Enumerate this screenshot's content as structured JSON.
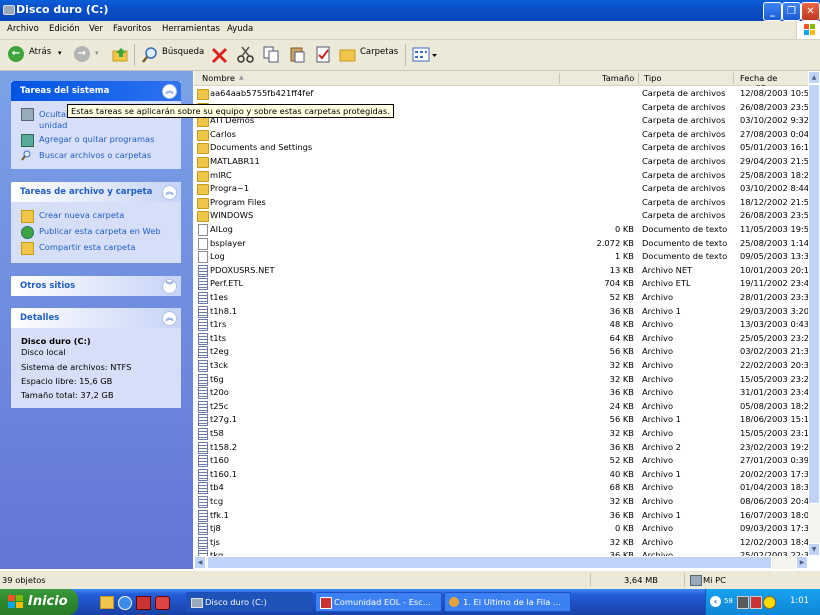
{
  "window": {
    "title": "Disco duro (C:)"
  },
  "menu": [
    "Archivo",
    "Edición",
    "Ver",
    "Favoritos",
    "Herramientas",
    "Ayuda"
  ],
  "toolbar": {
    "back": "Atrás",
    "search": "Búsqueda",
    "folders": "Carpetas"
  },
  "tooltip": "Estas tareas se aplicarán sobre su equipo y sobre estas carpetas protegidas.",
  "sidebar": {
    "system": {
      "title": "Tareas del sistema",
      "items": [
        "Ocultar el contenido de esta unidad",
        "Agregar o quitar programas",
        "Buscar archivos o carpetas"
      ]
    },
    "files": {
      "title": "Tareas de archivo y carpeta",
      "items": [
        "Crear nueva carpeta",
        "Publicar esta carpeta en Web",
        "Compartir esta carpeta"
      ]
    },
    "other": {
      "title": "Otros sitios"
    },
    "details": {
      "title": "Detalles",
      "name": "Disco duro (C:)",
      "type": "Disco local",
      "fs": "Sistema de archivos: NTFS",
      "free": "Espacio libre: 15,6 GB",
      "total": "Tamaño total: 37,2 GB"
    }
  },
  "columns": {
    "name": "Nombre",
    "size": "Tamaño",
    "type": "Tipo",
    "date": "Fecha de modific"
  },
  "files": [
    {
      "name": "aa64aab5755fb421ff4fef",
      "size": "",
      "type": "Carpeta de archivos",
      "date": "12/08/2003 10:50",
      "icon": "folder-icon"
    },
    {
      "name": "Adobe",
      "size": "",
      "type": "Carpeta de archivos",
      "date": "26/08/2003 23:51",
      "icon": "folder-icon"
    },
    {
      "name": "ATI Demos",
      "size": "",
      "type": "Carpeta de archivos",
      "date": "03/10/2002 9:32",
      "icon": "folder-icon"
    },
    {
      "name": "Carlos",
      "size": "",
      "type": "Carpeta de archivos",
      "date": "27/08/2003 0:04",
      "icon": "folder-icon"
    },
    {
      "name": "Documents and Settings",
      "size": "",
      "type": "Carpeta de archivos",
      "date": "05/01/2003 16:15",
      "icon": "folder-icon"
    },
    {
      "name": "MATLABR11",
      "size": "",
      "type": "Carpeta de archivos",
      "date": "29/04/2003 21:57",
      "icon": "folder-icon"
    },
    {
      "name": "mIRC",
      "size": "",
      "type": "Carpeta de archivos",
      "date": "25/08/2003 18:29",
      "icon": "folder-icon"
    },
    {
      "name": "Progra~1",
      "size": "",
      "type": "Carpeta de archivos",
      "date": "03/10/2002 8:44",
      "icon": "folder-icon"
    },
    {
      "name": "Program Files",
      "size": "",
      "type": "Carpeta de archivos",
      "date": "18/12/2002 21:51",
      "icon": "folder-icon"
    },
    {
      "name": "WINDOWS",
      "size": "",
      "type": "Carpeta de archivos",
      "date": "26/08/2003 23:51",
      "icon": "folder-icon"
    },
    {
      "name": "AILog",
      "size": "0 KB",
      "type": "Documento de texto",
      "date": "11/05/2003 19:57",
      "icon": "text-file-icon"
    },
    {
      "name": "bsplayer",
      "size": "2.072 KB",
      "type": "Documento de texto",
      "date": "25/08/2003 1:14",
      "icon": "text-file-icon"
    },
    {
      "name": "Log",
      "size": "1 KB",
      "type": "Documento de texto",
      "date": "09/05/2003 13:34",
      "icon": "text-file-icon"
    },
    {
      "name": "PDOXUSRS.NET",
      "size": "13 KB",
      "type": "Archivo NET",
      "date": "10/01/2003 20:12",
      "icon": "file-icon"
    },
    {
      "name": "Perf.ETL",
      "size": "704 KB",
      "type": "Archivo ETL",
      "date": "19/11/2002 23:48",
      "icon": "file-icon"
    },
    {
      "name": "t1es",
      "size": "52 KB",
      "type": "Archivo",
      "date": "28/01/2003 23:31",
      "icon": "file-icon"
    },
    {
      "name": "t1h8.1",
      "size": "36 KB",
      "type": "Archivo 1",
      "date": "29/03/2003 3:20",
      "icon": "file-icon"
    },
    {
      "name": "t1rs",
      "size": "48 KB",
      "type": "Archivo",
      "date": "13/03/2003 0:43",
      "icon": "file-icon"
    },
    {
      "name": "t1ts",
      "size": "64 KB",
      "type": "Archivo",
      "date": "25/05/2003 23:24",
      "icon": "file-icon"
    },
    {
      "name": "t2eg",
      "size": "56 KB",
      "type": "Archivo",
      "date": "03/02/2003 21:34",
      "icon": "file-icon"
    },
    {
      "name": "t3ck",
      "size": "32 KB",
      "type": "Archivo",
      "date": "22/02/2003 20:38",
      "icon": "file-icon"
    },
    {
      "name": "t6g",
      "size": "32 KB",
      "type": "Archivo",
      "date": "15/05/2003 23:25",
      "icon": "file-icon"
    },
    {
      "name": "t20o",
      "size": "36 KB",
      "type": "Archivo",
      "date": "31/01/2003 23:49",
      "icon": "file-icon"
    },
    {
      "name": "t25c",
      "size": "24 KB",
      "type": "Archivo",
      "date": "05/08/2003 18:23",
      "icon": "file-icon"
    },
    {
      "name": "t27g.1",
      "size": "56 KB",
      "type": "Archivo 1",
      "date": "18/06/2003 15:17",
      "icon": "file-icon"
    },
    {
      "name": "t58",
      "size": "32 KB",
      "type": "Archivo",
      "date": "15/05/2003 23:16",
      "icon": "file-icon"
    },
    {
      "name": "t158.2",
      "size": "36 KB",
      "type": "Archivo 2",
      "date": "23/02/2003 19:27",
      "icon": "file-icon"
    },
    {
      "name": "t160",
      "size": "52 KB",
      "type": "Archivo",
      "date": "27/01/2003 0:39",
      "icon": "file-icon"
    },
    {
      "name": "t160.1",
      "size": "40 KB",
      "type": "Archivo 1",
      "date": "20/02/2003 17:36",
      "icon": "file-icon"
    },
    {
      "name": "tb4",
      "size": "68 KB",
      "type": "Archivo",
      "date": "01/04/2003 18:37",
      "icon": "file-icon"
    },
    {
      "name": "tcg",
      "size": "32 KB",
      "type": "Archivo",
      "date": "08/06/2003 20:44",
      "icon": "file-icon"
    },
    {
      "name": "tfk.1",
      "size": "36 KB",
      "type": "Archivo 1",
      "date": "16/07/2003 18:02",
      "icon": "file-icon"
    },
    {
      "name": "tj8",
      "size": "0 KB",
      "type": "Archivo",
      "date": "09/03/2003 17:32",
      "icon": "file-icon"
    },
    {
      "name": "tjs",
      "size": "32 KB",
      "type": "Archivo",
      "date": "12/02/2003 18:47",
      "icon": "file-icon"
    },
    {
      "name": "tkg",
      "size": "36 KB",
      "type": "Archivo",
      "date": "25/02/2003 22:39",
      "icon": "file-icon"
    }
  ],
  "status": {
    "objects": "39 objetos",
    "size": "3,64 MB",
    "location": "Mi PC"
  },
  "taskbar": {
    "start": "Inicio",
    "tasks": [
      "Disco duro (C:)",
      "Comunidad EOL - Esc...",
      "1. El Ultimo de la Fila ..."
    ],
    "clock": "1:01",
    "tray_num": "58"
  }
}
